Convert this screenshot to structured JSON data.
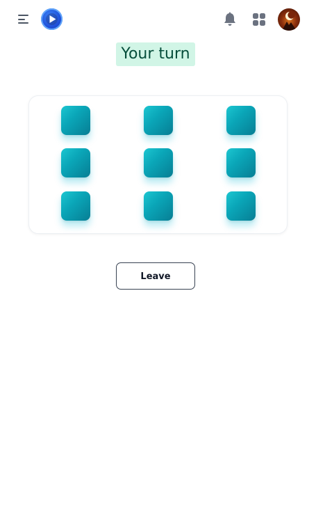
{
  "header": {
    "icons": [
      "menu-icon",
      "play-logo-icon",
      "bell-icon",
      "apps-grid-icon",
      "user-avatar"
    ]
  },
  "game": {
    "status": "Your turn",
    "board": {
      "rows": 3,
      "cols": 3,
      "cells": [
        "",
        "",
        "",
        "",
        "",
        "",
        "",
        "",
        ""
      ]
    },
    "leave_label": "Leave"
  },
  "colors": {
    "accent_tile": "#0aa6b8",
    "status_bg": "#d1f5e6",
    "status_text": "#064e3b",
    "logo": "#1d4ed8",
    "icon": "#4b5563"
  }
}
